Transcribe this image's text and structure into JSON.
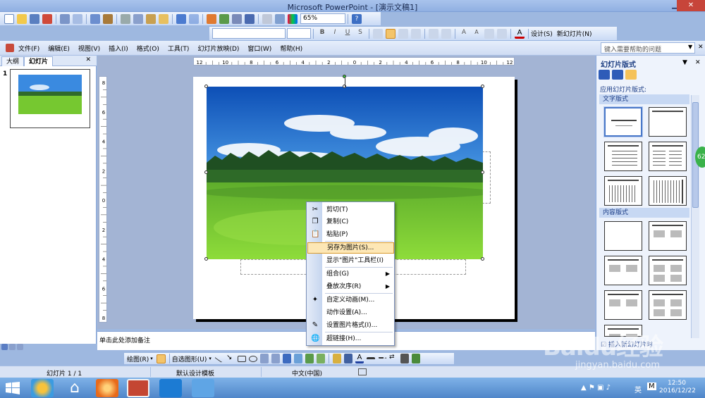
{
  "window": {
    "title": "Microsoft PowerPoint - [演示文稿1]"
  },
  "toolbar": {
    "zoom": "65%",
    "help_icon": "help-icon",
    "font_name": "",
    "font_size": "",
    "design_label": "设计(S)",
    "new_slide_label": "新幻灯片(N)"
  },
  "menubar": {
    "items": [
      "文件(F)",
      "编辑(E)",
      "视图(V)",
      "插入(I)",
      "格式(O)",
      "工具(T)",
      "幻灯片放映(D)",
      "窗口(W)",
      "帮助(H)"
    ]
  },
  "help": {
    "placeholder": "键入需要帮助的问题"
  },
  "leftpane": {
    "tabs": [
      "大纲",
      "幻灯片"
    ],
    "slide_number": "1"
  },
  "ruler": {
    "h": [
      "12",
      "10",
      "8",
      "6",
      "4",
      "2",
      "0",
      "2",
      "4",
      "6",
      "8",
      "10",
      "12"
    ],
    "v": [
      "8",
      "6",
      "4",
      "2",
      "0",
      "2",
      "4",
      "6",
      "8"
    ]
  },
  "context_menu": {
    "items": [
      {
        "label": "剪切(T)",
        "icon": "scissors-icon"
      },
      {
        "label": "复制(C)",
        "icon": "copy-icon"
      },
      {
        "label": "粘贴(P)",
        "icon": "paste-icon"
      },
      {
        "label": "另存为图片(S)...",
        "icon": ""
      },
      {
        "label": "显示\"图片\"工具栏(I)",
        "icon": ""
      },
      {
        "label": "组合(G)",
        "icon": "",
        "submenu": true
      },
      {
        "label": "叠放次序(R)",
        "icon": "",
        "submenu": true
      },
      {
        "label": "自定义动画(M)...",
        "icon": "animation-icon"
      },
      {
        "label": "动作设置(A)...",
        "icon": ""
      },
      {
        "label": "设置图片格式(I)...",
        "icon": "format-picture-icon"
      },
      {
        "label": "超链接(H)...",
        "icon": "hyperlink-icon"
      }
    ],
    "highlighted": 3
  },
  "notes": {
    "placeholder": "单击此处添加备注"
  },
  "drawbar": {
    "draw_label": "绘图(R)",
    "autoshape_label": "自选图形(U)"
  },
  "status": {
    "slide": "幻灯片 1 / 1",
    "template": "默认设计模板",
    "language": "中文(中国)"
  },
  "taskpane": {
    "title": "幻灯片版式",
    "apply_label": "应用幻灯片版式:",
    "section_text": "文字版式",
    "section_content": "内容版式",
    "show_on_insert": "插入新幻灯片时"
  },
  "watermark": {
    "brand": "Baidu经验",
    "url": "jingyan.baidu.com"
  },
  "badge": "62",
  "taskbar": {
    "time": "12:50",
    "date": "2016/12/22",
    "ime": "英",
    "ime_mode": "M"
  },
  "colors": {
    "accent": "#2e5cb8",
    "menu_highlight": "#fde7b5",
    "sky": "#2a78d8",
    "grass": "#6dc42a"
  }
}
